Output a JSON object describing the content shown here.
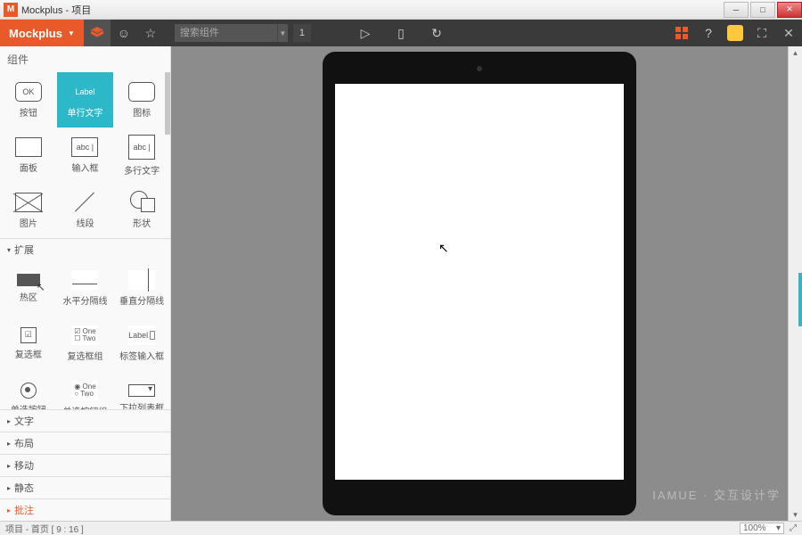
{
  "window": {
    "app_logo": "M",
    "title": "Mockplus - 项目"
  },
  "winbtns": {
    "min": "─",
    "max": "□",
    "close": "✕"
  },
  "toolbar": {
    "brand": "Mockplus",
    "search_placeholder": "搜索组件",
    "page_num": "1"
  },
  "sidebar": {
    "header": "组件",
    "groups": {
      "basic": [
        {
          "id": "button",
          "label": "按钮",
          "glyph": "OK"
        },
        {
          "id": "label",
          "label": "单行文字",
          "glyph": "Label",
          "selected": true
        },
        {
          "id": "icon",
          "label": "图标",
          "glyph": ""
        },
        {
          "id": "panel",
          "label": "面板",
          "glyph": ""
        },
        {
          "id": "input",
          "label": "输入框",
          "glyph": "abc |"
        },
        {
          "id": "textarea",
          "label": "多行文字",
          "glyph": "abc |"
        },
        {
          "id": "image",
          "label": "图片",
          "glyph": ""
        },
        {
          "id": "line",
          "label": "线段",
          "glyph": ""
        },
        {
          "id": "shape",
          "label": "形状",
          "glyph": ""
        }
      ],
      "ext_header": "扩展",
      "ext": [
        {
          "id": "hotspot",
          "label": "热区"
        },
        {
          "id": "hrule",
          "label": "水平分隔线"
        },
        {
          "id": "vrule",
          "label": "垂直分隔线"
        },
        {
          "id": "checkbox",
          "label": "复选框",
          "glyph": "☑"
        },
        {
          "id": "checkgroup",
          "label": "复选框组",
          "glyph": "☑ One\n☐ Two"
        },
        {
          "id": "labelinput",
          "label": "标签输入框",
          "glyph": "Label"
        },
        {
          "id": "radio",
          "label": "单选按钮"
        },
        {
          "id": "radiogroup",
          "label": "单选按钮组",
          "glyph": "◉ One\n○ Two"
        },
        {
          "id": "dropdown",
          "label": "下拉列表框"
        }
      ]
    },
    "sections": [
      {
        "id": "text",
        "label": "文字"
      },
      {
        "id": "layout",
        "label": "布局"
      },
      {
        "id": "move",
        "label": "移动"
      },
      {
        "id": "static",
        "label": "静态"
      },
      {
        "id": "annot",
        "label": "批注",
        "active": true
      }
    ]
  },
  "status": {
    "left": "项目 - 首页 [ 9 : 16 ]",
    "zoom": "100%"
  },
  "watermark": "IAMUE · 交互设计学"
}
